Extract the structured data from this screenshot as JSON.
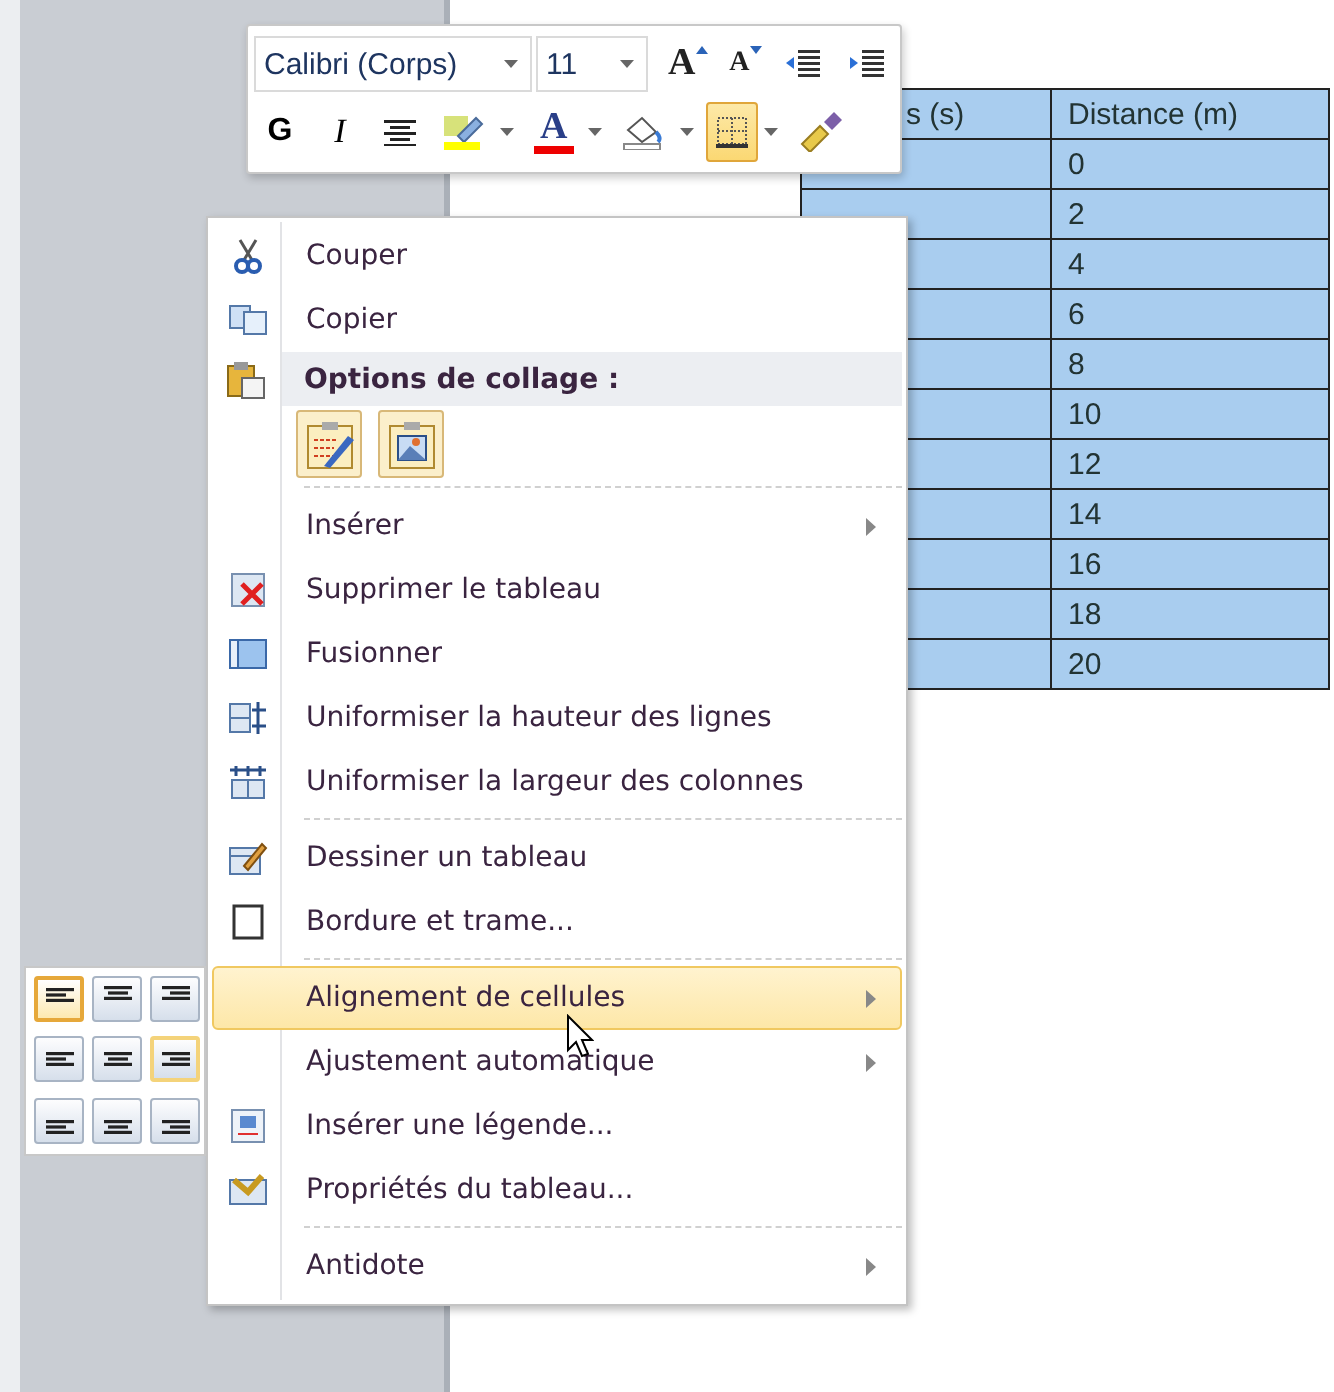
{
  "toolbar": {
    "font": {
      "value": "Calibri (Corps)"
    },
    "size": {
      "value": "11"
    },
    "row_1": [
      {
        "kind": "grow",
        "label": "A",
        "selected": false
      },
      {
        "kind": "shrink",
        "label": "A",
        "selected": false
      },
      {
        "kind": "outdent",
        "selected": false
      },
      {
        "kind": "indent",
        "selected": false
      }
    ],
    "row_2": [
      {
        "kind": "bold",
        "label": "G",
        "selected": false,
        "dropdown": false
      },
      {
        "kind": "italic",
        "label": "I",
        "selected": false,
        "dropdown": false
      },
      {
        "kind": "center",
        "selected": false,
        "dropdown": false
      },
      {
        "kind": "highlight",
        "selected": false,
        "dropdown": true
      },
      {
        "kind": "fontcolor",
        "label": "A",
        "selected": false,
        "dropdown": true
      },
      {
        "kind": "shading",
        "selected": false,
        "dropdown": true
      },
      {
        "kind": "borders",
        "selected": true,
        "dropdown": true
      },
      {
        "kind": "painter",
        "selected": false,
        "dropdown": false
      }
    ]
  },
  "table": {
    "columns": [
      "s (s)",
      "Distance (m)"
    ],
    "rows": [
      [
        "",
        "0"
      ],
      [
        "",
        "2"
      ],
      [
        "",
        "4"
      ],
      [
        "",
        "6"
      ],
      [
        "",
        "8"
      ],
      [
        "",
        "10"
      ],
      [
        "",
        "12"
      ],
      [
        "",
        "14"
      ],
      [
        "",
        "16"
      ],
      [
        "",
        "18"
      ],
      [
        "",
        "20"
      ]
    ]
  },
  "context_menu": [
    {
      "kind": "item",
      "label": "Couper",
      "submenu": false,
      "selected": false
    },
    {
      "kind": "item",
      "label": "Copier",
      "submenu": false,
      "selected": false
    },
    {
      "kind": "header",
      "label": "Options de collage :"
    },
    {
      "kind": "paste"
    },
    {
      "kind": "separator"
    },
    {
      "kind": "item",
      "label": "Insérer",
      "submenu": true,
      "selected": false
    },
    {
      "kind": "item",
      "label": "Supprimer le tableau",
      "submenu": false,
      "selected": false
    },
    {
      "kind": "item",
      "label": "Fusionner",
      "submenu": false,
      "selected": false
    },
    {
      "kind": "item",
      "label": "Uniformiser la hauteur des lignes",
      "submenu": false,
      "selected": false
    },
    {
      "kind": "item",
      "label": "Uniformiser la largeur des colonnes",
      "submenu": false,
      "selected": false
    },
    {
      "kind": "separator"
    },
    {
      "kind": "item",
      "label": "Dessiner un tableau",
      "submenu": false,
      "selected": false
    },
    {
      "kind": "item",
      "label": "Bordure et trame...",
      "submenu": false,
      "selected": false
    },
    {
      "kind": "separator"
    },
    {
      "kind": "item",
      "label": "Alignement de cellules",
      "submenu": true,
      "selected": true
    },
    {
      "kind": "item",
      "label": "Ajustement automatique",
      "submenu": true,
      "selected": false
    },
    {
      "kind": "item",
      "label": "Insérer une légende...",
      "submenu": false,
      "selected": false
    },
    {
      "kind": "item",
      "label": "Propriétés du tableau...",
      "submenu": false,
      "selected": false
    },
    {
      "kind": "separator"
    },
    {
      "kind": "item",
      "label": "Antidote",
      "submenu": true,
      "selected": false
    }
  ],
  "alignment_palette": [
    {
      "kind": "top_left",
      "selected": true,
      "hovered": false
    },
    {
      "kind": "top_center",
      "selected": false,
      "hovered": false
    },
    {
      "kind": "top_right",
      "selected": false,
      "hovered": false
    },
    {
      "kind": "middle_left",
      "selected": false,
      "hovered": false
    },
    {
      "kind": "middle_center",
      "selected": false,
      "hovered": false
    },
    {
      "kind": "middle_right",
      "selected": false,
      "hovered": true
    },
    {
      "kind": "bottom_left",
      "selected": false,
      "hovered": false
    },
    {
      "kind": "bottom_center",
      "selected": false,
      "hovered": false
    },
    {
      "kind": "bottom_right",
      "selected": false,
      "hovered": false
    }
  ]
}
